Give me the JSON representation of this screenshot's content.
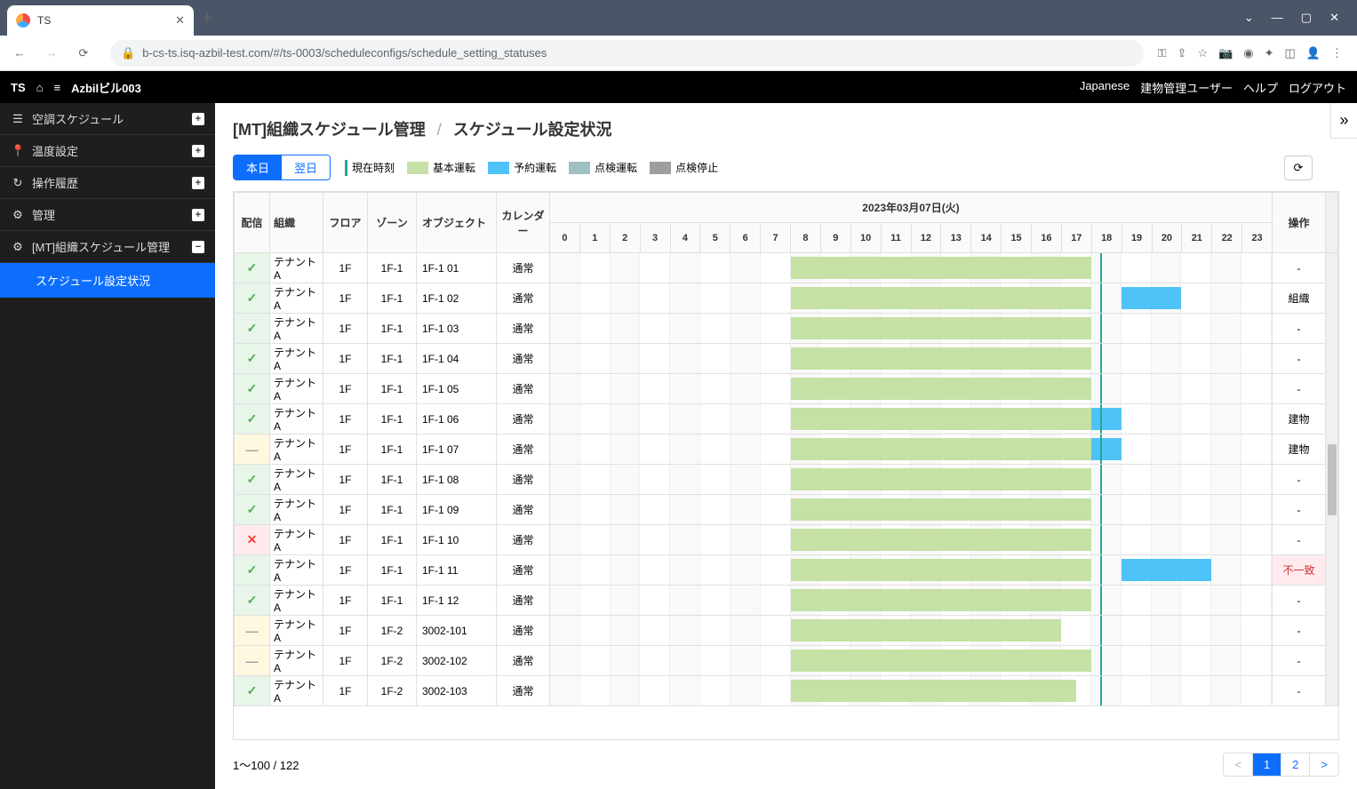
{
  "browser": {
    "tab_title": "TS",
    "url": "b-cs-ts.isq-azbil-test.com/#/ts-0003/scheduleconfigs/schedule_setting_statuses"
  },
  "header": {
    "logo": "TS",
    "building": "Azbilビル003",
    "lang": "Japanese",
    "user": "建物管理ユーザー",
    "help": "ヘルプ",
    "logout": "ログアウト"
  },
  "sidebar": {
    "items": [
      {
        "icon": "☰",
        "label": "空調スケジュール",
        "expand": "+"
      },
      {
        "icon": "📍",
        "label": "温度設定",
        "expand": "+"
      },
      {
        "icon": "↻",
        "label": "操作履歴",
        "expand": "+"
      },
      {
        "icon": "⚙",
        "label": "管理",
        "expand": "+"
      },
      {
        "icon": "⚙",
        "label": "[MT]組織スケジュール管理",
        "expand": "−"
      }
    ],
    "sub": "スケジュール設定状況"
  },
  "breadcrumb": {
    "parent": "[MT]組織スケジュール管理",
    "current": "スケジュール設定状況"
  },
  "controls": {
    "today": "本日",
    "tomorrow": "翌日",
    "legend": {
      "now": "現在時刻",
      "basic": "基本運転",
      "booking": "予約運転",
      "inspect": "点検運転",
      "stop": "点検停止"
    }
  },
  "table": {
    "date_header": "2023年03月07日(火)",
    "headers": {
      "dist": "配信",
      "org": "組織",
      "floor": "フロア",
      "zone": "ゾーン",
      "obj": "オブジェクト",
      "cal": "カレンダー",
      "op": "操作"
    },
    "hours": [
      "0",
      "1",
      "2",
      "3",
      "4",
      "5",
      "6",
      "7",
      "8",
      "9",
      "10",
      "11",
      "12",
      "13",
      "14",
      "15",
      "16",
      "17",
      "18",
      "19",
      "20",
      "21",
      "22",
      "23"
    ],
    "now_hour": 18.3,
    "rows": [
      {
        "dist": "check",
        "org": "テナントA",
        "floor": "1F",
        "zone": "1F-1",
        "obj": "1F-1 01",
        "cal": "通常",
        "bars": [
          {
            "type": "basic",
            "from": 8,
            "to": 18
          }
        ],
        "op": "-"
      },
      {
        "dist": "check",
        "org": "テナントA",
        "floor": "1F",
        "zone": "1F-1",
        "obj": "1F-1 02",
        "cal": "通常",
        "bars": [
          {
            "type": "basic",
            "from": 8,
            "to": 18
          },
          {
            "type": "booking",
            "from": 19,
            "to": 21
          }
        ],
        "op": "組織"
      },
      {
        "dist": "check",
        "org": "テナントA",
        "floor": "1F",
        "zone": "1F-1",
        "obj": "1F-1 03",
        "cal": "通常",
        "bars": [
          {
            "type": "basic",
            "from": 8,
            "to": 18
          }
        ],
        "op": "-"
      },
      {
        "dist": "check",
        "org": "テナントA",
        "floor": "1F",
        "zone": "1F-1",
        "obj": "1F-1 04",
        "cal": "通常",
        "bars": [
          {
            "type": "basic",
            "from": 8,
            "to": 18
          }
        ],
        "op": "-"
      },
      {
        "dist": "check",
        "org": "テナントA",
        "floor": "1F",
        "zone": "1F-1",
        "obj": "1F-1 05",
        "cal": "通常",
        "bars": [
          {
            "type": "basic",
            "from": 8,
            "to": 18
          }
        ],
        "op": "-"
      },
      {
        "dist": "check",
        "org": "テナントA",
        "floor": "1F",
        "zone": "1F-1",
        "obj": "1F-1 06",
        "cal": "通常",
        "bars": [
          {
            "type": "basic",
            "from": 8,
            "to": 18
          },
          {
            "type": "booking",
            "from": 18,
            "to": 19
          }
        ],
        "op": "建物"
      },
      {
        "dist": "dash",
        "org": "テナントA",
        "floor": "1F",
        "zone": "1F-1",
        "obj": "1F-1 07",
        "cal": "通常",
        "bars": [
          {
            "type": "basic",
            "from": 8,
            "to": 18
          },
          {
            "type": "booking",
            "from": 18,
            "to": 19
          }
        ],
        "op": "建物"
      },
      {
        "dist": "check",
        "org": "テナントA",
        "floor": "1F",
        "zone": "1F-1",
        "obj": "1F-1 08",
        "cal": "通常",
        "bars": [
          {
            "type": "basic",
            "from": 8,
            "to": 18
          }
        ],
        "op": "-"
      },
      {
        "dist": "check",
        "org": "テナントA",
        "floor": "1F",
        "zone": "1F-1",
        "obj": "1F-1 09",
        "cal": "通常",
        "bars": [
          {
            "type": "basic",
            "from": 8,
            "to": 18
          }
        ],
        "op": "-"
      },
      {
        "dist": "x",
        "org": "テナントA",
        "floor": "1F",
        "zone": "1F-1",
        "obj": "1F-1 10",
        "cal": "通常",
        "bars": [
          {
            "type": "basic",
            "from": 8,
            "to": 18
          }
        ],
        "op": "-"
      },
      {
        "dist": "check",
        "org": "テナントA",
        "floor": "1F",
        "zone": "1F-1",
        "obj": "1F-1 11",
        "cal": "通常",
        "bars": [
          {
            "type": "basic",
            "from": 8,
            "to": 18
          },
          {
            "type": "booking",
            "from": 19,
            "to": 22
          }
        ],
        "op": "不一致",
        "op_mismatch": true
      },
      {
        "dist": "check",
        "org": "テナントA",
        "floor": "1F",
        "zone": "1F-1",
        "obj": "1F-1 12",
        "cal": "通常",
        "bars": [
          {
            "type": "basic",
            "from": 8,
            "to": 18
          }
        ],
        "op": "-"
      },
      {
        "dist": "dash",
        "org": "テナントA",
        "floor": "1F",
        "zone": "1F-2",
        "obj": "3002-101",
        "cal": "通常",
        "bars": [
          {
            "type": "basic",
            "from": 8,
            "to": 17
          }
        ],
        "op": "-"
      },
      {
        "dist": "dash",
        "org": "テナントA",
        "floor": "1F",
        "zone": "1F-2",
        "obj": "3002-102",
        "cal": "通常",
        "bars": [
          {
            "type": "basic",
            "from": 8,
            "to": 18
          }
        ],
        "op": "-"
      },
      {
        "dist": "check",
        "org": "テナントA",
        "floor": "1F",
        "zone": "1F-2",
        "obj": "3002-103",
        "cal": "通常",
        "bars": [
          {
            "type": "basic",
            "from": 8,
            "to": 17.5
          }
        ],
        "op": "-"
      }
    ]
  },
  "footer": {
    "count": "1～100 / 122",
    "pages": [
      "<",
      "1",
      "2",
      ">"
    ],
    "active_page": "1"
  },
  "colors": {
    "now": "#26a69a",
    "basic": "#c5e1a5",
    "booking": "#4fc3f7",
    "inspect": "#9ebfc4",
    "stop": "#9e9e9e"
  }
}
